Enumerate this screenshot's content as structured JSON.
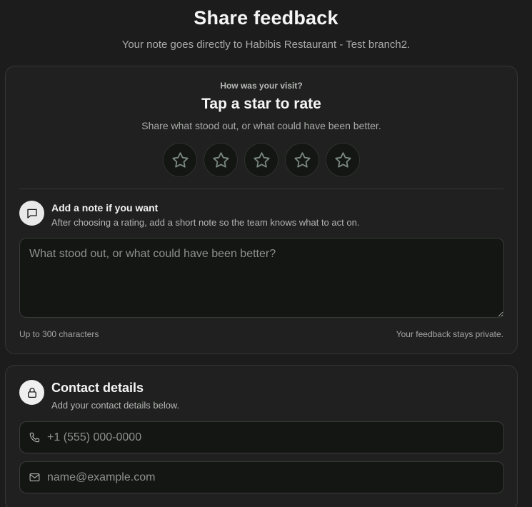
{
  "header": {
    "title": "Share feedback",
    "subtitle": "Your note goes directly to Habibis Restaurant - Test branch2."
  },
  "rating": {
    "eyebrow": "How was your visit?",
    "title": "Tap a star to rate",
    "hint": "Share what stood out, or what could have been better.",
    "max_stars": 5,
    "selected": 0
  },
  "note": {
    "icon": "message-square-icon",
    "title": "Add a note if you want",
    "description": "After choosing a rating, add a short note so the team knows what to act on.",
    "placeholder": "What stood out, or what could have been better?",
    "value": "",
    "char_limit_text": "Up to 300 characters",
    "privacy_text": "Your feedback stays private."
  },
  "contact": {
    "icon": "lock-icon",
    "title": "Contact details",
    "description": "Add your contact details below.",
    "phone": {
      "icon": "phone-icon",
      "placeholder": "+1 (555) 000-0000",
      "value": ""
    },
    "email": {
      "icon": "mail-icon",
      "placeholder": "name@example.com",
      "value": ""
    }
  },
  "colors": {
    "background": "#1c1c1c",
    "card": "#1f201f",
    "star_outline": "#7b8a80"
  }
}
